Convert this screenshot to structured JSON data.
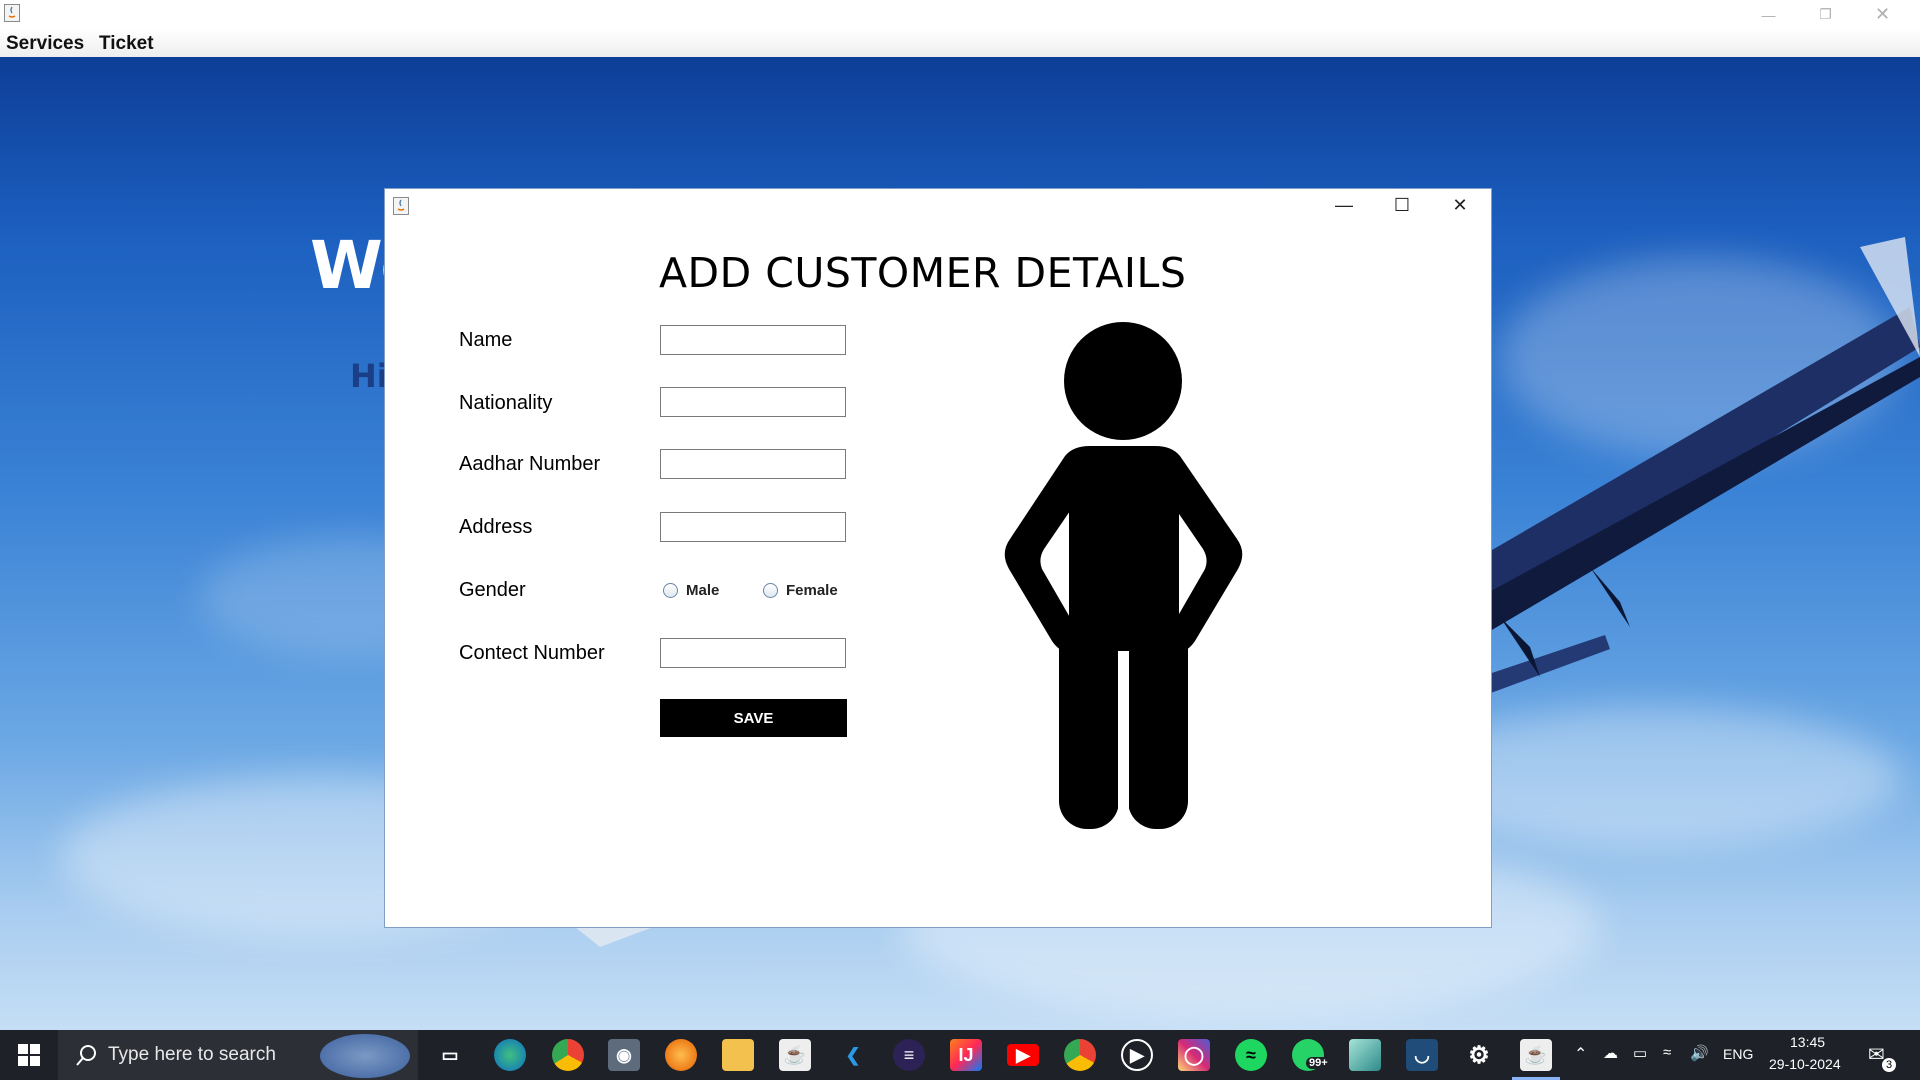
{
  "main_window": {
    "menu": [
      "Services",
      "Ticket"
    ],
    "welcome_text": "We",
    "hi_text": "Hi"
  },
  "dialog": {
    "title": "ADD CUSTOMER DETAILS",
    "fields": [
      {
        "label": "Name",
        "value": ""
      },
      {
        "label": "Nationality",
        "value": ""
      },
      {
        "label": "Aadhar Number",
        "value": ""
      },
      {
        "label": "Address",
        "value": ""
      },
      {
        "label": "Contect Number",
        "value": ""
      }
    ],
    "gender_label": "Gender",
    "gender_options": [
      "Male",
      "Female"
    ],
    "save_label": "SAVE",
    "illustration": "person-silhouette-icon"
  },
  "taskbar": {
    "search_placeholder": "Type here to search",
    "pinned_apps": [
      "task-view",
      "edge",
      "chrome",
      "camera",
      "firefox",
      "file-explorer",
      "java",
      "vscode",
      "eclipse",
      "intellij",
      "youtube",
      "chrome-profile",
      "media-player",
      "instagram",
      "spotify",
      "whatsapp",
      "notepad",
      "mysql-workbench",
      "settings",
      "java-running"
    ],
    "whatsapp_badge": "99+",
    "language": "ENG",
    "time": "13:45",
    "date": "29-10-2024",
    "notification_count": "3"
  },
  "colors": {
    "sky_top": "#0d3e98",
    "sky_bottom": "#c5def5",
    "taskbar": "#1e2127",
    "save_button": "#000000"
  }
}
